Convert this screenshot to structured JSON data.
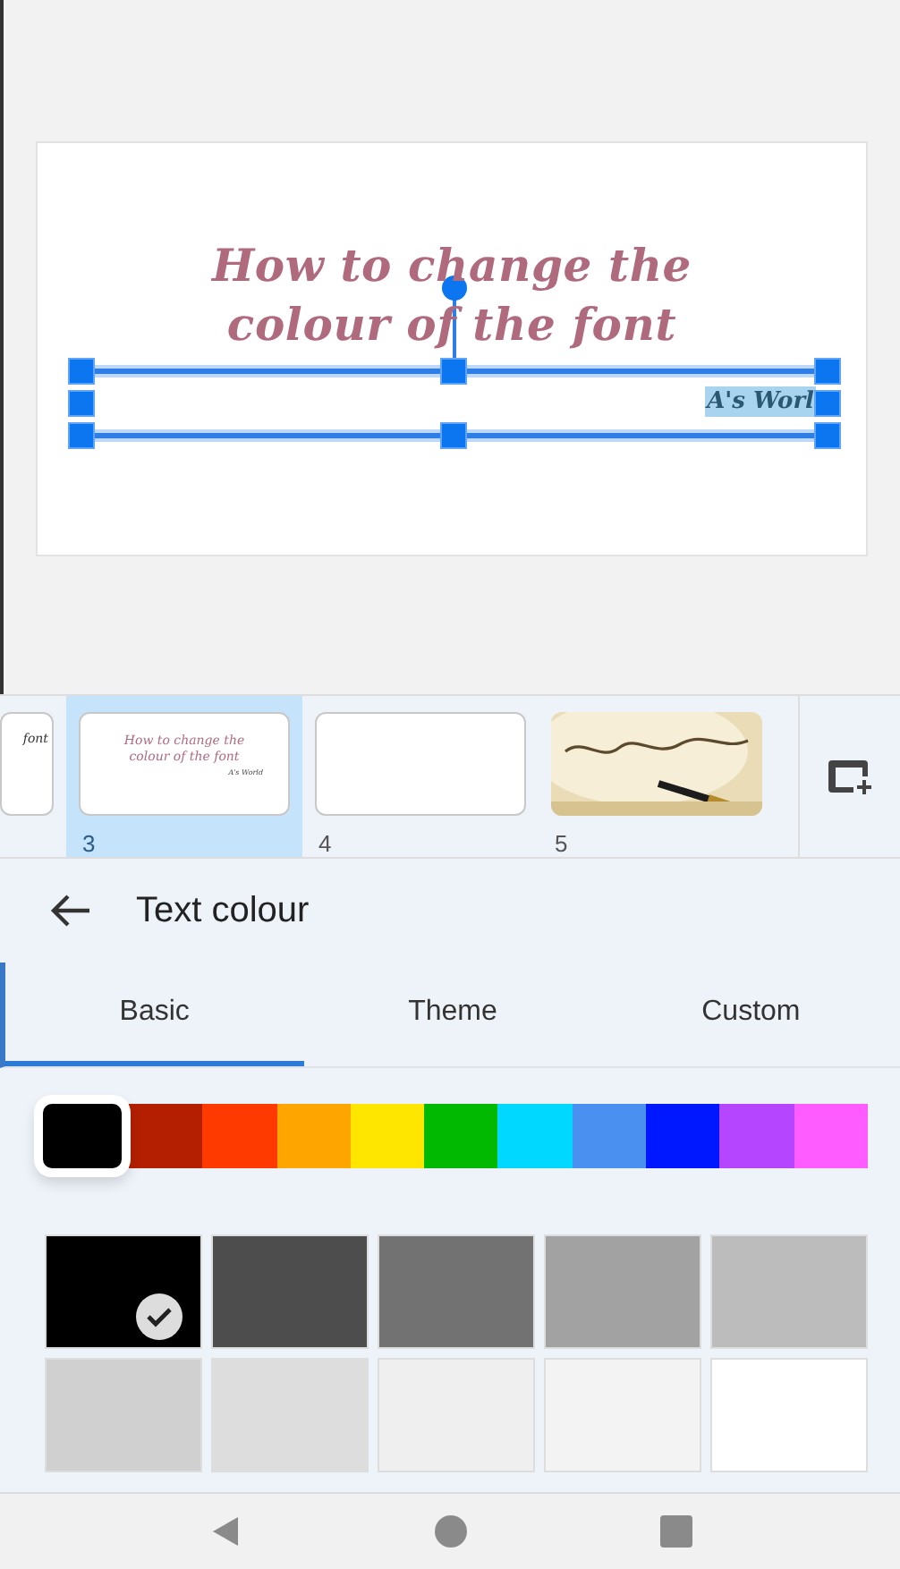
{
  "slide": {
    "title_lines": [
      "How to change the",
      "colour of the font"
    ],
    "textbox_text": "A's Worl"
  },
  "filmstrip": [
    {
      "kind": "partial",
      "texts": [
        "font"
      ],
      "selected": false
    },
    {
      "kind": "slide",
      "texts": [
        "How to change the",
        "colour of the font",
        "A's World"
      ],
      "number": "3",
      "selected": true
    },
    {
      "kind": "blank",
      "number": "4",
      "selected": false
    },
    {
      "kind": "picture",
      "number": "5",
      "selected": false
    }
  ],
  "panel": {
    "title": "Text colour"
  },
  "tabs": [
    {
      "label": "Basic",
      "selected": true
    },
    {
      "label": "Theme",
      "selected": false
    },
    {
      "label": "Custom",
      "selected": false
    }
  ],
  "hues": [
    {
      "color": "#000000",
      "selected": true
    },
    {
      "color": "#b31f00",
      "selected": false
    },
    {
      "color": "#ff3a00",
      "selected": false
    },
    {
      "color": "#ffa500",
      "selected": false
    },
    {
      "color": "#ffe600",
      "selected": false
    },
    {
      "color": "#00b900",
      "selected": false
    },
    {
      "color": "#00d8ff",
      "selected": false
    },
    {
      "color": "#4a90f0",
      "selected": false
    },
    {
      "color": "#0018ff",
      "selected": false
    },
    {
      "color": "#b545ff",
      "selected": false
    },
    {
      "color": "#ff5cff",
      "selected": false
    }
  ],
  "shades": [
    {
      "color": "#000000",
      "selected": true
    },
    {
      "color": "#4d4d4d",
      "selected": false
    },
    {
      "color": "#727272",
      "selected": false
    },
    {
      "color": "#a2a2a2",
      "selected": false
    },
    {
      "color": "#bcbcbc",
      "selected": false
    },
    {
      "color": "#d0d0d0",
      "selected": false
    },
    {
      "color": "#dddddd",
      "selected": false
    },
    {
      "color": "#efefef",
      "selected": false
    },
    {
      "color": "#f3f3f3",
      "selected": false
    },
    {
      "color": "#ffffff",
      "selected": false
    }
  ]
}
